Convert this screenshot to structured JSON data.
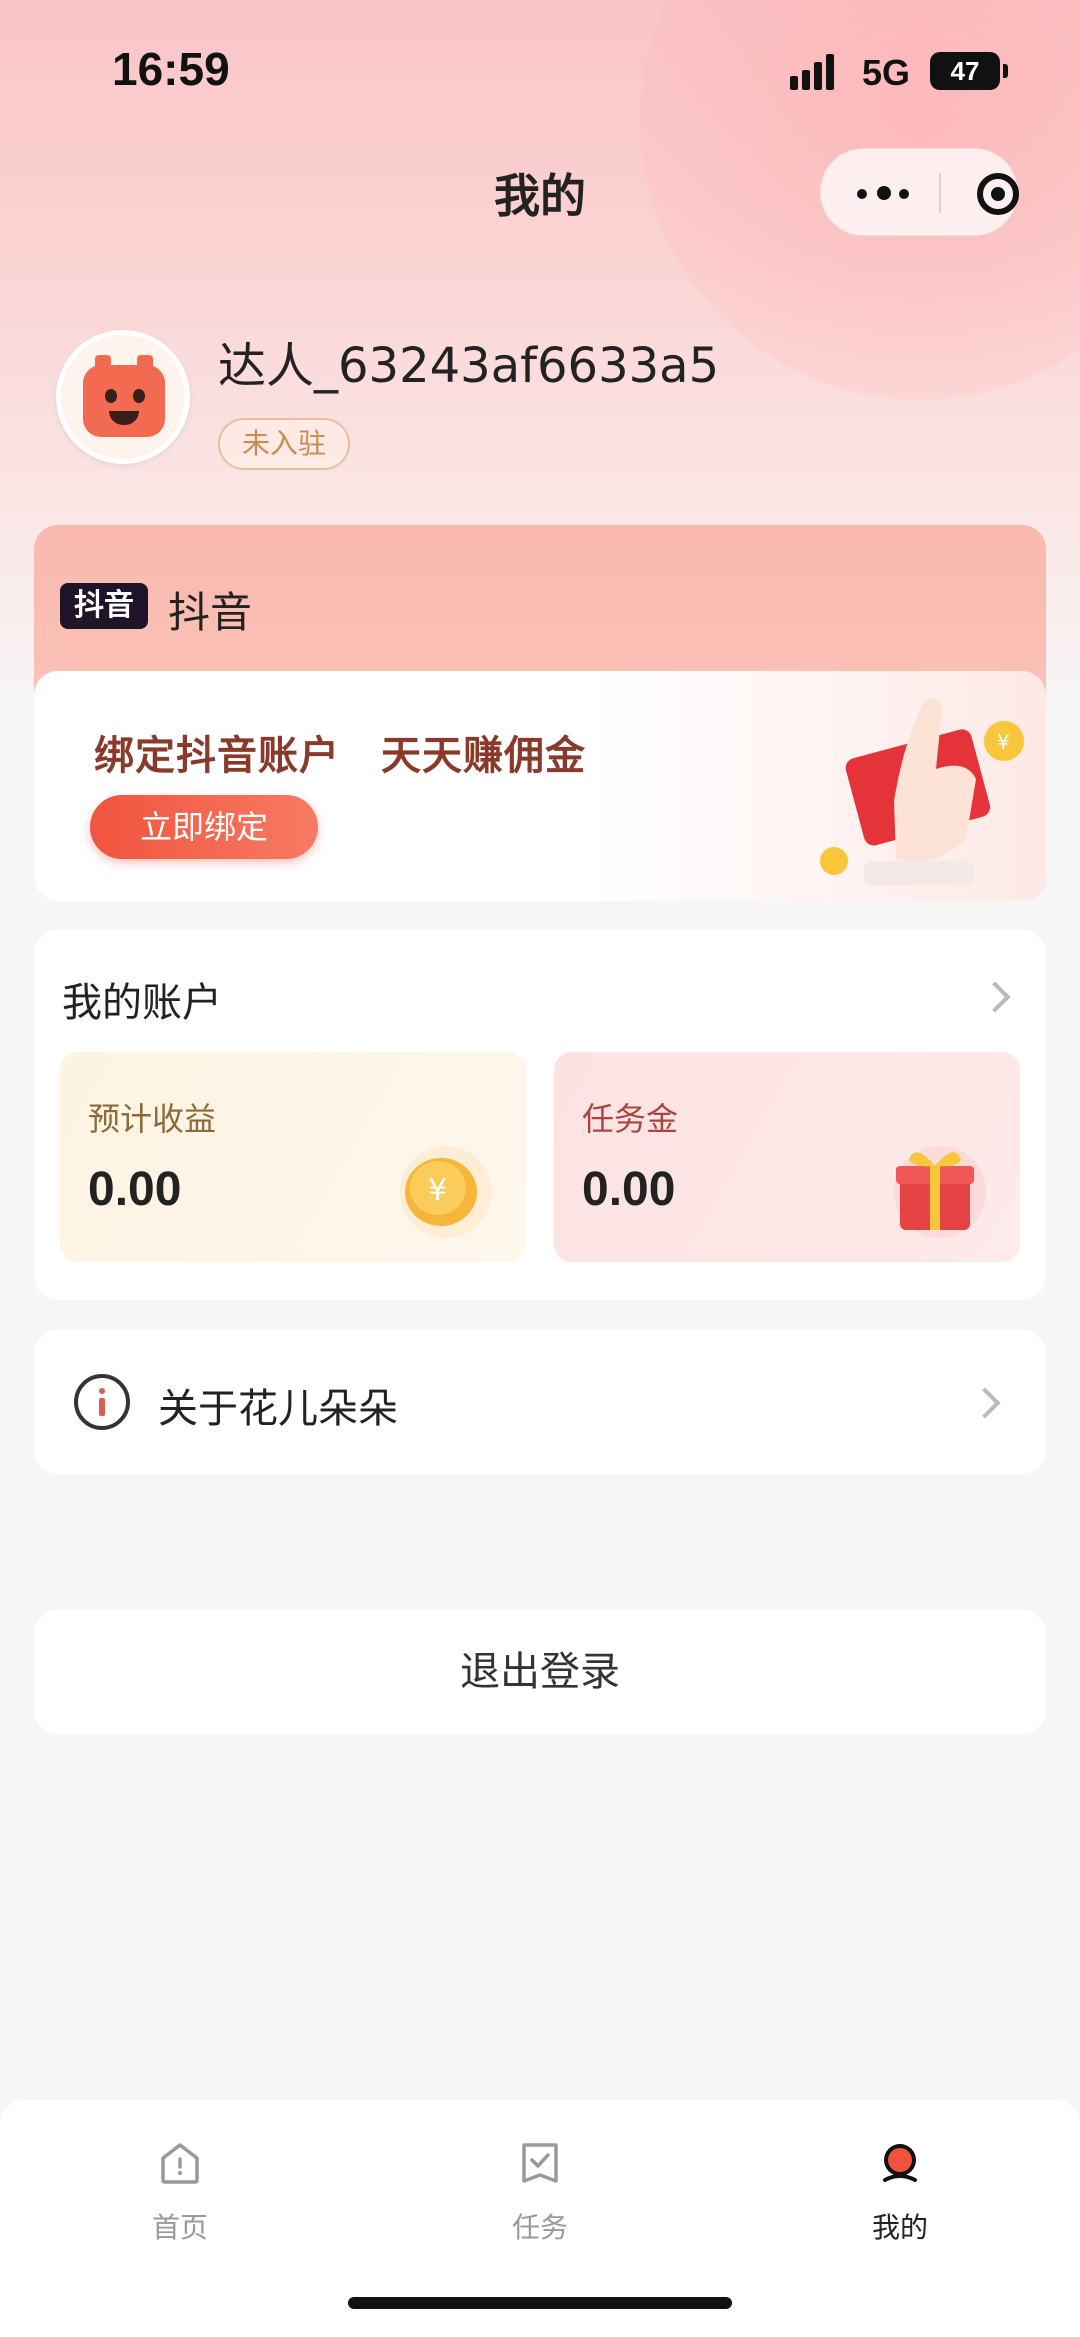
{
  "status_bar": {
    "time": "16:59",
    "network": "5G",
    "battery": "47"
  },
  "nav": {
    "title": "我的"
  },
  "profile": {
    "username": "达人_63243af6633a5",
    "badge": "未入驻"
  },
  "douyin_card": {
    "logo_text": "抖音",
    "platform_name": "抖音",
    "slogan": "绑定抖音账户　天天赚佣金",
    "bind_button": "立即绑定"
  },
  "account": {
    "title": "我的账户",
    "estimated_income": {
      "label": "预计收益",
      "value": "0.00"
    },
    "task_money": {
      "label": "任务金",
      "value": "0.00"
    }
  },
  "about": {
    "label": "关于花儿朵朵"
  },
  "logout": {
    "label": "退出登录"
  },
  "tabbar": {
    "items": [
      {
        "label": "首页",
        "icon": "home-icon",
        "active": false
      },
      {
        "label": "任务",
        "icon": "task-icon",
        "active": false
      },
      {
        "label": "我的",
        "icon": "profile-icon",
        "active": true
      }
    ]
  },
  "colors": {
    "accent": "#f0543f",
    "background": "#f6f6f6",
    "badge": "#c98b54"
  }
}
